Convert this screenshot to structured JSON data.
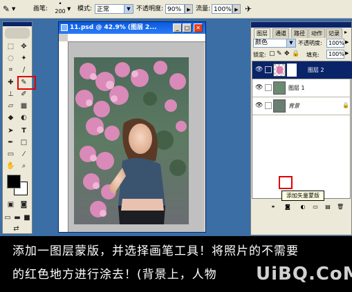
{
  "options_bar": {
    "brush_label": "画笔:",
    "brush_size": "200",
    "mode_label": "模式:",
    "mode_value": "正常",
    "opacity_label": "不透明度:",
    "opacity_value": "90%",
    "flow_label": "流量:",
    "flow_value": "100%"
  },
  "document": {
    "title": "11.psd @ 42.9% (图层 2..."
  },
  "layers_panel": {
    "tabs": [
      "图层",
      "通道",
      "路径",
      "动作",
      "记录"
    ],
    "blend_mode": "颜色",
    "opacity_label": "不透明度:",
    "opacity_value": "100%",
    "lock_label": "锁定:",
    "fill_label": "填充:",
    "fill_value": "100%",
    "layers": [
      {
        "name": "图层 2",
        "selected": true
      },
      {
        "name": "图层 1",
        "selected": false
      },
      {
        "name": "背景",
        "selected": false,
        "locked": true
      }
    ],
    "tooltip": "添加矢量蒙版"
  },
  "caption": {
    "line1": "添加一图层蒙版，并选择画笔工具！将照片的不需要",
    "line2": "的红色地方进行涂去！(背景上，人物",
    "watermark": "UiBQ.CoM"
  },
  "colors": {
    "highlight": "#e00000",
    "titlebar": "#0a5ae0",
    "workspace": "#3a6ea5"
  }
}
